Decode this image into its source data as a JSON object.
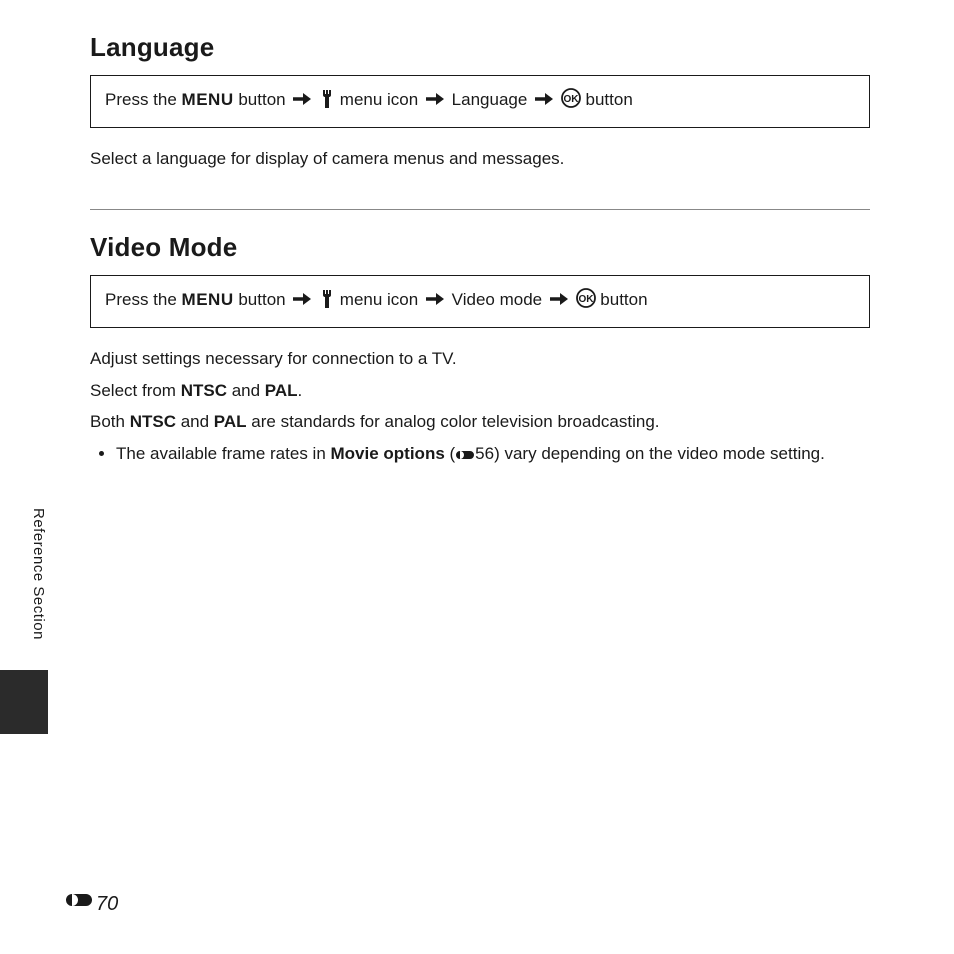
{
  "section1": {
    "heading": "Language",
    "nav": {
      "prefix": "Press the ",
      "menu": "MENU",
      "btn": " button ",
      "menuicon_after": " menu icon ",
      "item": " Language ",
      "ok_after": " button"
    },
    "desc": "Select a language for display of camera menus and messages."
  },
  "section2": {
    "heading": "Video Mode",
    "nav": {
      "prefix": "Press the ",
      "menu": "MENU",
      "btn": " button ",
      "menuicon_after": " menu icon ",
      "item": " Video mode ",
      "ok_after": " button"
    },
    "desc1": "Adjust settings necessary for connection to a TV.",
    "desc2_a": "Select from ",
    "desc2_ntsc": "NTSC",
    "desc2_b": " and ",
    "desc2_pal": "PAL",
    "desc2_c": ".",
    "desc3_a": "Both ",
    "desc3_ntsc": "NTSC",
    "desc3_b": " and ",
    "desc3_pal": "PAL",
    "desc3_c": " are standards for analog color television broadcasting.",
    "bullet_a": "The available frame rates in ",
    "bullet_movie": "Movie options",
    "bullet_b": " (",
    "bullet_ref": "56",
    "bullet_c": ") vary depending on the video mode setting."
  },
  "side_label": "Reference Section",
  "page_number": "70"
}
